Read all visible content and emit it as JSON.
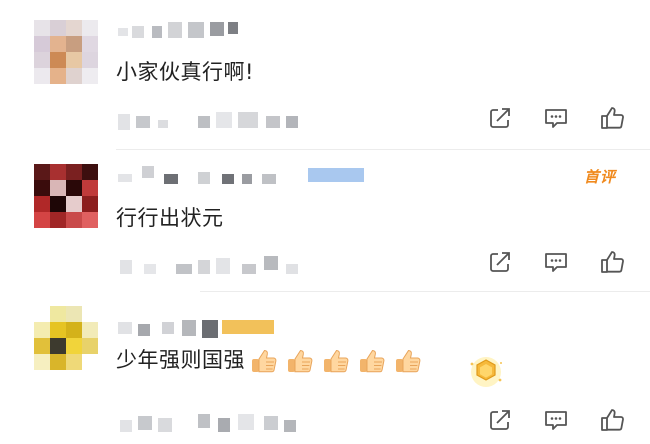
{
  "comments": [
    {
      "text": "小家伙真行啊!",
      "avatar": "blurred-avatar",
      "username": "",
      "badge": "",
      "has_emojis": false
    },
    {
      "text": "行行出状元",
      "avatar": "blurred-avatar",
      "username": "",
      "badge": "首评",
      "has_emojis": false
    },
    {
      "text": "少年强则国强",
      "avatar": "blurred-avatar",
      "username": "",
      "badge": "",
      "has_emojis": true,
      "emoji_name": "thumbs-up-emoji",
      "emoji_count": 5,
      "sticker": "gold-medal-icon"
    }
  ],
  "actions": {
    "share_icon": "share-icon",
    "reply_icon": "comment-icon",
    "like_icon": "thumbs-up-icon"
  },
  "colors": {
    "text": "#222222",
    "icon": "#555555",
    "top_badge": "#f08a1e",
    "blur_gray": "#c9cbd0"
  }
}
